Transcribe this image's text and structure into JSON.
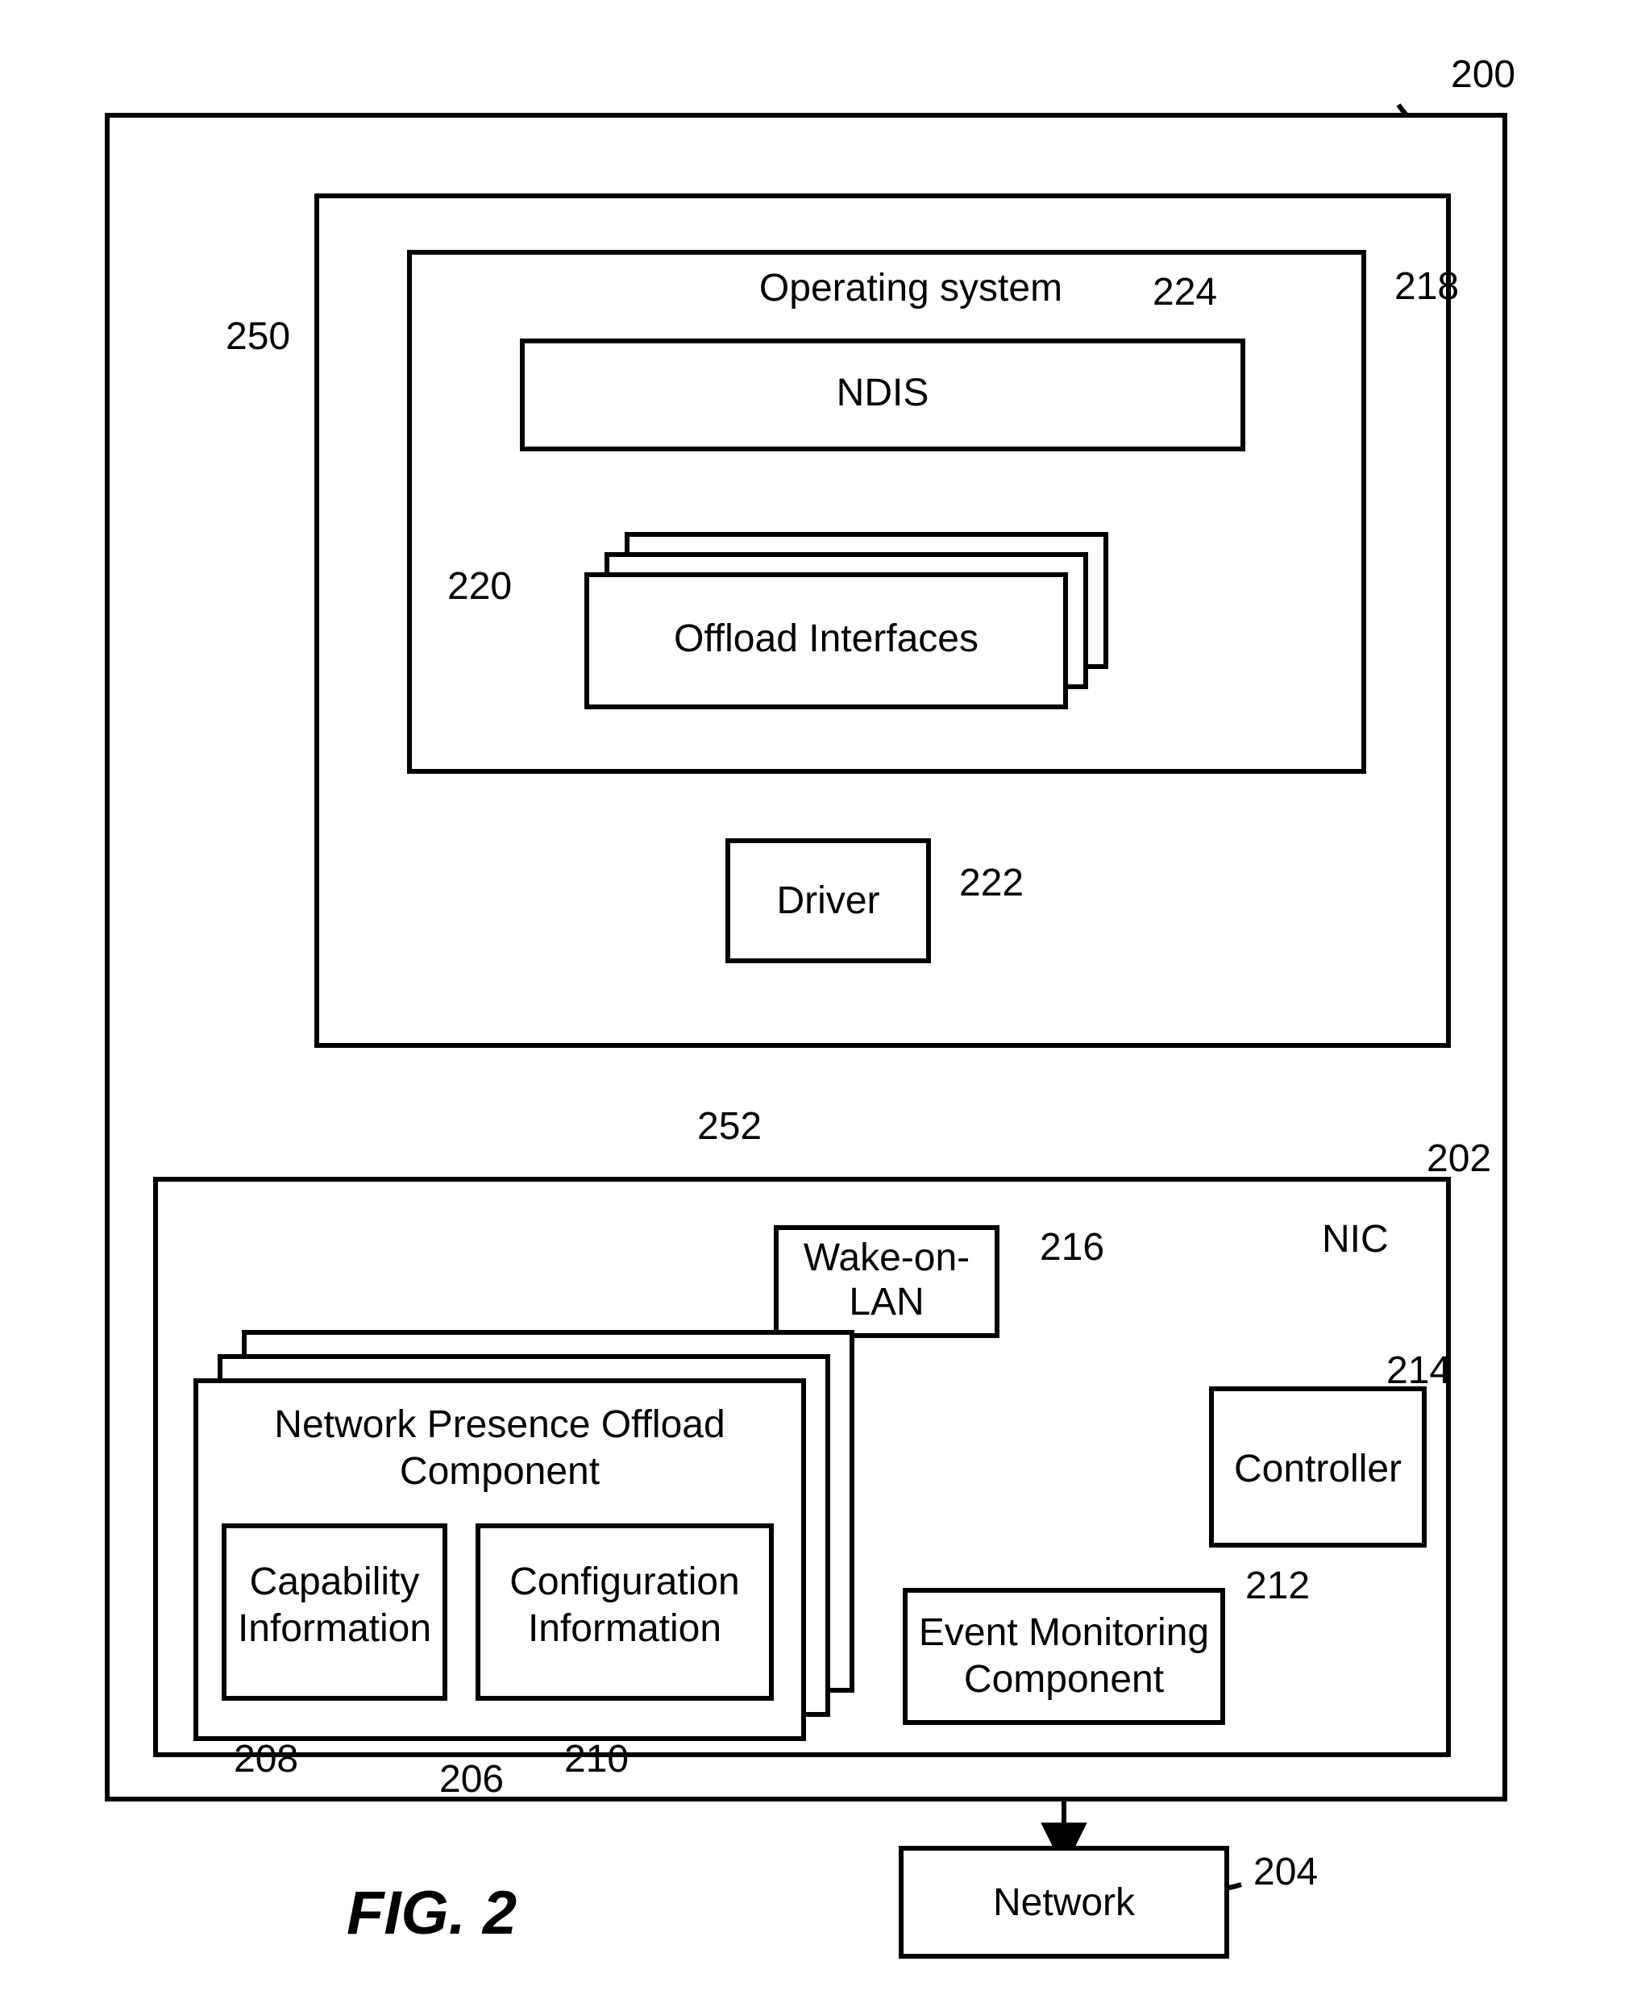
{
  "figure_label": "FIG. 2",
  "refs": {
    "r200": "200",
    "r250": "250",
    "r218": "218",
    "r224": "224",
    "r220": "220",
    "r222": "222",
    "r252": "252",
    "r202": "202",
    "r216": "216",
    "r214": "214",
    "r212": "212",
    "r208": "208",
    "r210": "210",
    "r206": "206",
    "r204": "204"
  },
  "text": {
    "os_title": "Operating system",
    "ndis": "NDIS",
    "offload_if": "Offload Interfaces",
    "driver": "Driver",
    "nic": "NIC",
    "wol_l1": "Wake-on-",
    "wol_l2": "LAN",
    "controller": "Controller",
    "npoc_l1": "Network Presence Offload",
    "npoc_l2": "Component",
    "cap_l1": "Capability",
    "cap_l2": "Information",
    "cfg_l1": "Configuration",
    "cfg_l2": "Information",
    "emc_l1": "Event Monitoring",
    "emc_l2": "Component",
    "network": "Network"
  }
}
